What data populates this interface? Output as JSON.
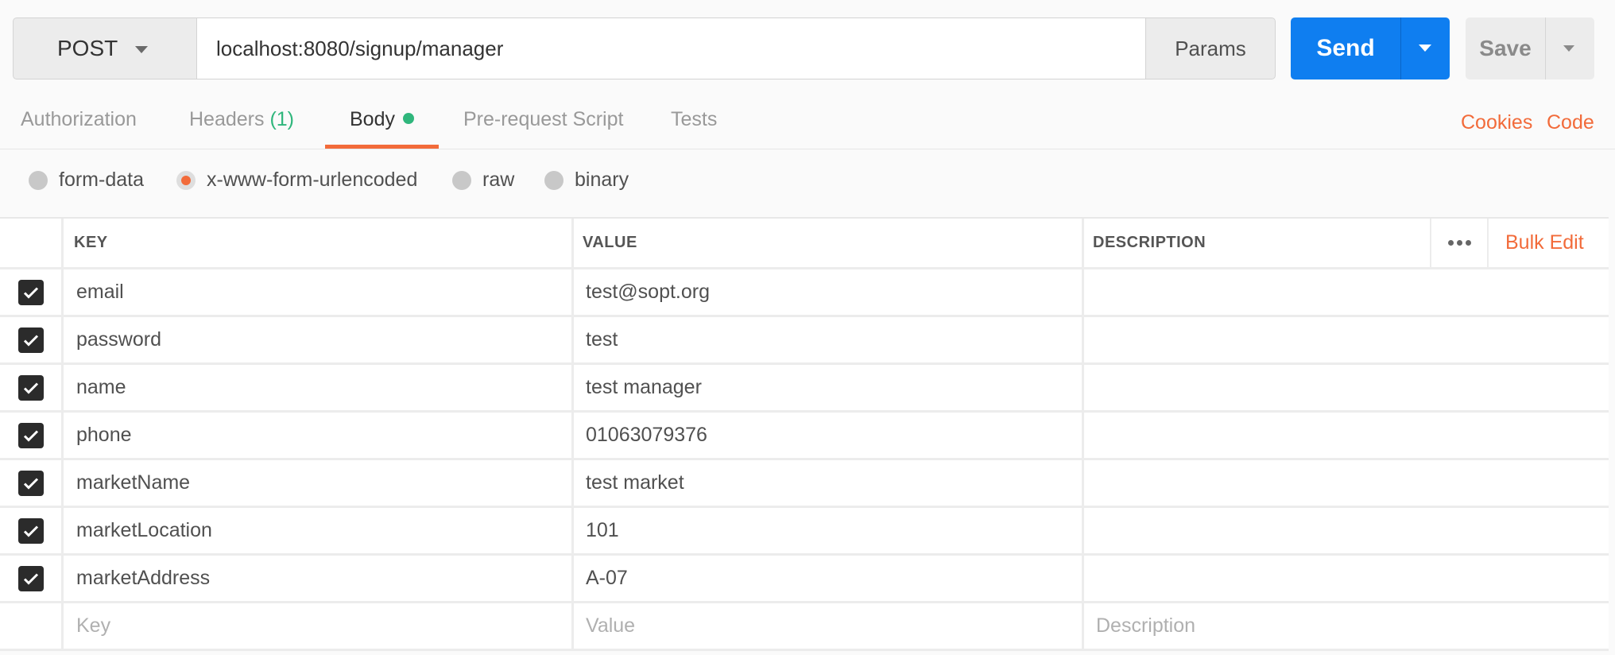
{
  "request": {
    "method": "POST",
    "url": "localhost:8080/signup/manager",
    "params_label": "Params",
    "send_label": "Send",
    "save_label": "Save"
  },
  "tabs": {
    "authorization": "Authorization",
    "headers": "Headers",
    "headers_count": "(1)",
    "body": "Body",
    "prerequest": "Pre-request Script",
    "tests": "Tests",
    "cookies": "Cookies",
    "code": "Code"
  },
  "body_types": {
    "form_data": "form-data",
    "urlencoded": "x-www-form-urlencoded",
    "raw": "raw",
    "binary": "binary",
    "selected": "x-www-form-urlencoded"
  },
  "table": {
    "headers": {
      "key": "KEY",
      "value": "VALUE",
      "description": "DESCRIPTION",
      "bulk_edit": "Bulk Edit"
    },
    "rows": [
      {
        "key": "email",
        "value": "test@sopt.org",
        "description": ""
      },
      {
        "key": "password",
        "value": "test",
        "description": ""
      },
      {
        "key": "name",
        "value": "test manager",
        "description": ""
      },
      {
        "key": "phone",
        "value": "01063079376",
        "description": ""
      },
      {
        "key": "marketName",
        "value": "test market",
        "description": ""
      },
      {
        "key": "marketLocation",
        "value": "101",
        "description": ""
      },
      {
        "key": "marketAddress",
        "value": "A-07",
        "description": ""
      }
    ],
    "placeholders": {
      "key": "Key",
      "value": "Value",
      "description": "Description"
    }
  },
  "colors": {
    "accent": "#f26b3a",
    "send": "#0f7ef0",
    "active_dot": "#2fb67c"
  }
}
